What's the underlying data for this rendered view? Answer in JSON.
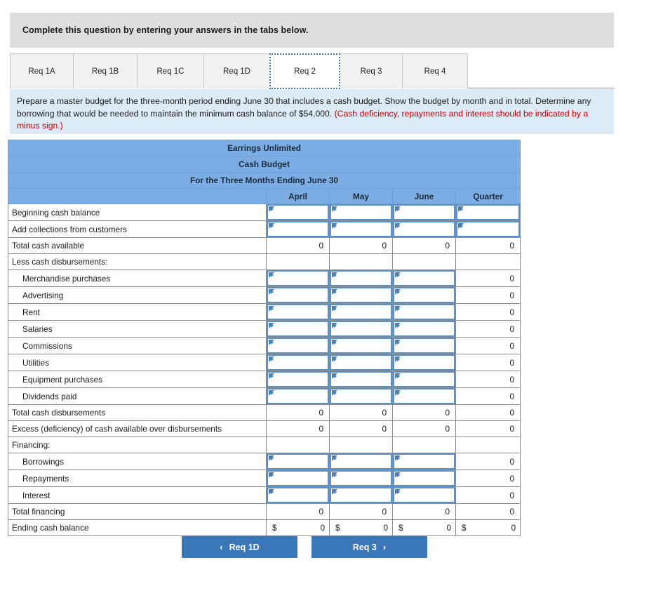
{
  "banner": {
    "text": "Complete this question by entering your answers in the tabs below."
  },
  "tabs": [
    {
      "label": "Req 1A",
      "active": false
    },
    {
      "label": "Req 1B",
      "active": false
    },
    {
      "label": "Req 1C",
      "active": false
    },
    {
      "label": "Req 1D",
      "active": false
    },
    {
      "label": "Req 2",
      "active": true
    },
    {
      "label": "Req 3",
      "active": false
    },
    {
      "label": "Req 4",
      "active": false
    }
  ],
  "requirement": {
    "body": "Prepare a master budget for the three-month period ending June 30 that includes a cash budget. Show the budget by month and in total. Determine any borrowing that would be needed to maintain the minimum cash balance of $54,000. ",
    "note": "(Cash deficiency, repayments and interest should be indicated by a minus sign.)"
  },
  "sheet": {
    "title_line1": "Earrings Unlimited",
    "title_line2": "Cash Budget",
    "title_line3": "For the Three Months Ending June 30",
    "columns": [
      "",
      "April",
      "May",
      "June",
      "Quarter"
    ],
    "currency_symbol": "$",
    "rows": [
      {
        "label": "Beginning cash balance",
        "indent": false,
        "cells": [
          "input",
          "input",
          "input",
          "input"
        ]
      },
      {
        "label": "Add collections from customers",
        "indent": false,
        "cells": [
          "input",
          "input",
          "input",
          "input"
        ]
      },
      {
        "label": "Total cash available",
        "indent": false,
        "cells": [
          "0",
          "0",
          "0",
          "0"
        ]
      },
      {
        "label": "Less cash disbursements:",
        "indent": false,
        "cells": [
          "",
          "",
          "",
          ""
        ]
      },
      {
        "label": "Merchandise purchases",
        "indent": true,
        "cells": [
          "input",
          "input",
          "input",
          "0"
        ]
      },
      {
        "label": "Advertising",
        "indent": true,
        "cells": [
          "input",
          "input",
          "input",
          "0"
        ]
      },
      {
        "label": "Rent",
        "indent": true,
        "cells": [
          "input",
          "input",
          "input",
          "0"
        ]
      },
      {
        "label": "Salaries",
        "indent": true,
        "cells": [
          "input",
          "input",
          "input",
          "0"
        ]
      },
      {
        "label": "Commissions",
        "indent": true,
        "cells": [
          "input",
          "input",
          "input",
          "0"
        ]
      },
      {
        "label": "Utilities",
        "indent": true,
        "cells": [
          "input",
          "input",
          "input",
          "0"
        ]
      },
      {
        "label": "Equipment purchases",
        "indent": true,
        "cells": [
          "input",
          "input",
          "input",
          "0"
        ]
      },
      {
        "label": "Dividends paid",
        "indent": true,
        "cells": [
          "input",
          "input",
          "input",
          "0"
        ]
      },
      {
        "label": "Total cash disbursements",
        "indent": false,
        "cells": [
          "0",
          "0",
          "0",
          "0"
        ]
      },
      {
        "label": "Excess (deficiency) of cash available over disbursements",
        "indent": false,
        "cells": [
          "0",
          "0",
          "0",
          "0"
        ]
      },
      {
        "label": "Financing:",
        "indent": false,
        "cells": [
          "",
          "",
          "",
          ""
        ]
      },
      {
        "label": "Borrowings",
        "indent": true,
        "cells": [
          "input",
          "input",
          "input",
          "0"
        ]
      },
      {
        "label": "Repayments",
        "indent": true,
        "cells": [
          "input",
          "input",
          "input",
          "0"
        ]
      },
      {
        "label": "Interest",
        "indent": true,
        "cells": [
          "input",
          "input",
          "input",
          "0"
        ]
      },
      {
        "label": "Total financing",
        "indent": false,
        "cells": [
          "0",
          "0",
          "0",
          "0"
        ]
      },
      {
        "label": "Ending cash balance",
        "indent": false,
        "cells": [
          "currency:0",
          "currency:0",
          "currency:0",
          "currency:0"
        ]
      }
    ]
  },
  "nav": {
    "prev_label": "Req 1D",
    "prev_chevron": "‹",
    "next_label": "Req 3",
    "next_chevron": "›"
  },
  "colors": {
    "header_blue": "#7badE4",
    "button_blue": "#3b76b8",
    "panel_blue": "#ddebf7",
    "banner_gray": "#dedede",
    "warn_red": "#c00000",
    "input_border": "#5b8fc9"
  }
}
